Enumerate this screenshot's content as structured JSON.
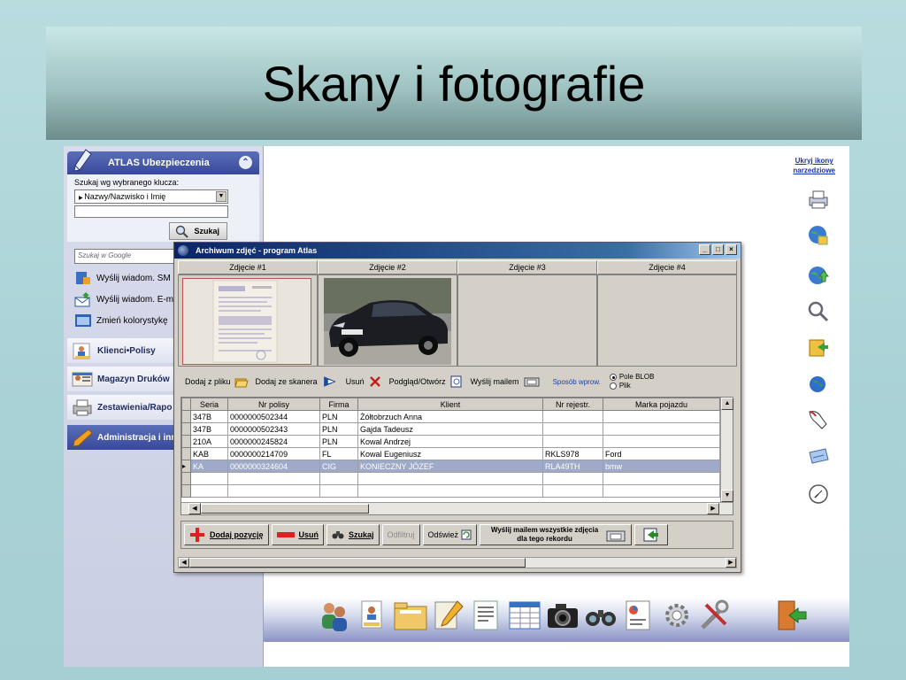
{
  "slide": {
    "title": "Skany i fotografie"
  },
  "sidebar": {
    "panel_title": "ATLAS Ubezpieczenia",
    "search_label": "Szukaj wg wybranego klucza:",
    "key_select": "Nazwy/Nazwisko i Imię",
    "search_button": "Szukaj",
    "google_placeholder": "Szukaj w Google",
    "links": [
      {
        "label": "Wyślij wiadom. SM"
      },
      {
        "label": "Wyślij wiadom. E-m"
      },
      {
        "label": "Zmień kolorystykę"
      }
    ],
    "sections": [
      {
        "label": "Klienci•Polisy"
      },
      {
        "label": "Magazyn Druków"
      },
      {
        "label": "Zestawienia/Rapo"
      }
    ],
    "admin_label": "Administracja i inn"
  },
  "right_tools": {
    "hide_label_1": "Ukryj ikony",
    "hide_label_2": "narzedziowe",
    "icons": [
      "printer-icon",
      "globe-lock-icon",
      "globe-upload-icon",
      "magnifier-icon",
      "folder-arrow-icon",
      "globe-icon",
      "pointer-hand-icon",
      "card-icon",
      "clock-icon"
    ]
  },
  "window": {
    "title": "Archiwum zdjęć - program  Atlas",
    "controls": [
      "_",
      "□",
      "×"
    ],
    "photo_headers": [
      "Zdjęcie #1",
      "Zdjęcie #2",
      "Zdjęcie #3",
      "Zdjęcie #4"
    ],
    "actions": {
      "add_file": "Dodaj z pliku",
      "add_scanner": "Dodaj ze skanera",
      "delete": "Usuń",
      "preview": "Podgląd/Otwórz",
      "send_mail": "Wyślij mailem",
      "mode_label": "Sposób wprow.",
      "mode_blob": "Pole BLOB",
      "mode_file": "Plik",
      "mode_selected": "Pole BLOB"
    },
    "grid": {
      "columns": [
        "Seria",
        "Nr polisy",
        "Firma",
        "Klient",
        "Nr rejestr.",
        "Marka pojazdu"
      ],
      "rows": [
        [
          "347B",
          "0000000502344",
          "PLN",
          "Żółtobrzuch Anna",
          "",
          ""
        ],
        [
          "347B",
          "0000000502343",
          "PLN",
          "Gajda Tadeusz",
          "",
          ""
        ],
        [
          "210A",
          "0000000245824",
          "PLN",
          "Kowal Andrzej",
          "",
          ""
        ],
        [
          "KAB",
          "0000000214709",
          "FL",
          "Kowal Eugeniusz",
          "RKLS978",
          "Ford"
        ],
        [
          "KA",
          "0000000324604",
          "CIG",
          "KONIECZNY JÓZEF",
          "RLA49TH",
          "bmw"
        ],
        [
          "",
          "",
          "",
          "",
          "",
          ""
        ],
        [
          "",
          "",
          "",
          "",
          "",
          ""
        ]
      ],
      "selected_index": 4
    },
    "buttons": {
      "add_position": "Dodaj pozycję",
      "delete": "Usuń",
      "search": "Szukaj",
      "unfilter": "Odfiltruj",
      "refresh": "Odśwież",
      "send_all_1": "Wyślij mailem wszystkie zdjęcia",
      "send_all_2": "dla tego rekordu"
    }
  }
}
